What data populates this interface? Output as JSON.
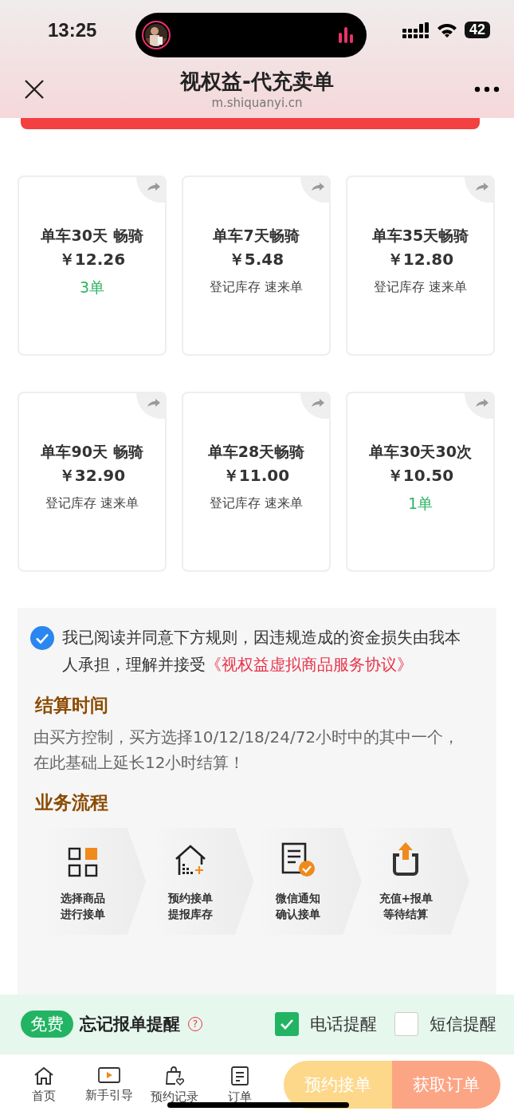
{
  "status_bar": {
    "time": "13:25",
    "battery": "42"
  },
  "header": {
    "title": "视权益-代充卖单",
    "url": "m.shiquanyi.cn"
  },
  "products": [
    {
      "title": "单车30天 畅骑",
      "price": "￥12.26",
      "status": "3单",
      "kind": "orders"
    },
    {
      "title": "单车7天畅骑",
      "price": "￥5.48",
      "status": "登记库存 速来单",
      "kind": "stock"
    },
    {
      "title": "单车35天畅骑",
      "price": "￥12.80",
      "status": "登记库存 速来单",
      "kind": "stock"
    },
    {
      "title": "单车90天 畅骑",
      "price": "￥32.90",
      "status": "登记库存 速来单",
      "kind": "stock"
    },
    {
      "title": "单车28天畅骑",
      "price": "￥11.00",
      "status": "登记库存 速来单",
      "kind": "stock"
    },
    {
      "title": "单车30天30次",
      "price": "￥10.50",
      "status": "1单",
      "kind": "orders"
    }
  ],
  "agreement": {
    "checked": true,
    "text": "我已阅读并同意下方规则，因违规造成的资金损失由我本人承担，理解并接受",
    "link": "《视权益虚拟商品服务协议》"
  },
  "settlement": {
    "heading": "结算时间",
    "text": "由买方控制，买方选择10/12/18/24/72小时中的其中一个，在此基础上延长12小时结算！"
  },
  "process": {
    "heading": "业务流程",
    "steps": [
      {
        "kind": "grid",
        "lines": [
          "选择商品",
          "进行接单"
        ]
      },
      {
        "kind": "house",
        "lines": [
          "预约接单",
          "提报库存"
        ]
      },
      {
        "kind": "document",
        "lines": [
          "微信通知",
          "确认接单"
        ]
      },
      {
        "kind": "upload",
        "lines": [
          "充值+报单",
          "等待结算"
        ]
      }
    ]
  },
  "reminder": {
    "badge": "免费",
    "label": "忘记报单提醒",
    "help": "?",
    "options": [
      {
        "label": "电话提醒",
        "checked": true
      },
      {
        "label": "短信提醒",
        "checked": false
      }
    ]
  },
  "nav": [
    {
      "kind": "home",
      "label": "首页"
    },
    {
      "kind": "video",
      "label": "新手引导"
    },
    {
      "kind": "bag",
      "label": "预约记录"
    },
    {
      "kind": "note",
      "label": "订单"
    }
  ],
  "actions": [
    {
      "label": "预约接单",
      "kind": "reserve"
    },
    {
      "label": "获取订单",
      "kind": "fetch"
    }
  ]
}
